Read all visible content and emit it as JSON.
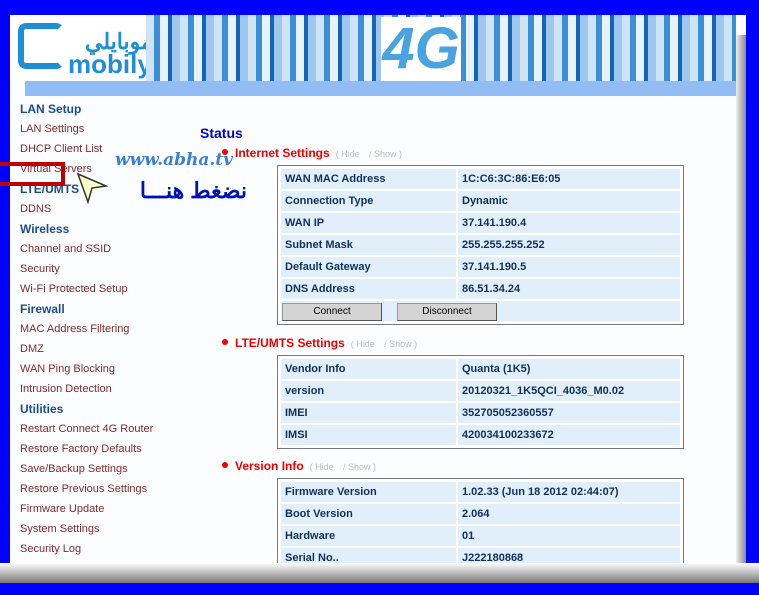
{
  "header": {
    "logo_arabic": "موبايلي",
    "logo_text": "mobily",
    "banner_text": "4G"
  },
  "sidebar": [
    {
      "label": "LAN Setup",
      "heading": true
    },
    {
      "label": "LAN Settings"
    },
    {
      "label": "DHCP Client List"
    },
    {
      "label": "Virtual Servers"
    },
    {
      "label": "LTE/UMTS",
      "heading": true
    },
    {
      "label": "DDNS"
    },
    {
      "label": "Wireless",
      "heading": true
    },
    {
      "label": "Channel and SSID"
    },
    {
      "label": "Security"
    },
    {
      "label": "Wi-Fi Protected Setup"
    },
    {
      "label": "Firewall",
      "heading": true
    },
    {
      "label": "MAC Address Filtering"
    },
    {
      "label": "DMZ"
    },
    {
      "label": "WAN Ping Blocking"
    },
    {
      "label": "Intrusion Detection"
    },
    {
      "label": "Utilities",
      "heading": true
    },
    {
      "label": "Restart Connect 4G Router"
    },
    {
      "label": "Restore Factory Defaults"
    },
    {
      "label": "Save/Backup Settings"
    },
    {
      "label": "Restore Previous Settings"
    },
    {
      "label": "Firmware Update"
    },
    {
      "label": "System Settings"
    },
    {
      "label": "Security Log"
    }
  ],
  "main": {
    "title": "Status",
    "hide_label": "( Hide",
    "show_label": "/  Show )",
    "sections": [
      {
        "title": "Internet Settings",
        "rows": [
          [
            "WAN MAC Address",
            "1C:C6:3C:86:E6:05"
          ],
          [
            "Connection Type",
            "Dynamic"
          ],
          [
            "WAN IP",
            "37.141.190.4"
          ],
          [
            "Subnet Mask",
            "255.255.255.252"
          ],
          [
            "Default Gateway",
            "37.141.190.5"
          ],
          [
            "DNS Address",
            "86.51.34.24"
          ]
        ],
        "buttons": [
          "Connect",
          "Disconnect"
        ]
      },
      {
        "title": "LTE/UMTS Settings",
        "rows": [
          [
            "Vendor Info",
            "Quanta (1K5)"
          ],
          [
            "version",
            "20120321_1K5QCI_4036_M0.02"
          ],
          [
            "IMEI",
            "352705052360557"
          ],
          [
            "IMSI",
            "420034100233672"
          ]
        ]
      },
      {
        "title": "Version Info",
        "rows": [
          [
            "Firmware Version",
            "1.02.33 (Jun 18 2012 02:44:07)"
          ],
          [
            "Boot Version",
            "2.064"
          ],
          [
            "Hardware",
            "01"
          ],
          [
            "Serial No..",
            "J222180868"
          ]
        ]
      }
    ]
  },
  "overlay": {
    "watermark": "www.abha.tv",
    "arabic_hint": "نضغط هنـــا",
    "highlight_color": "#c00000"
  }
}
